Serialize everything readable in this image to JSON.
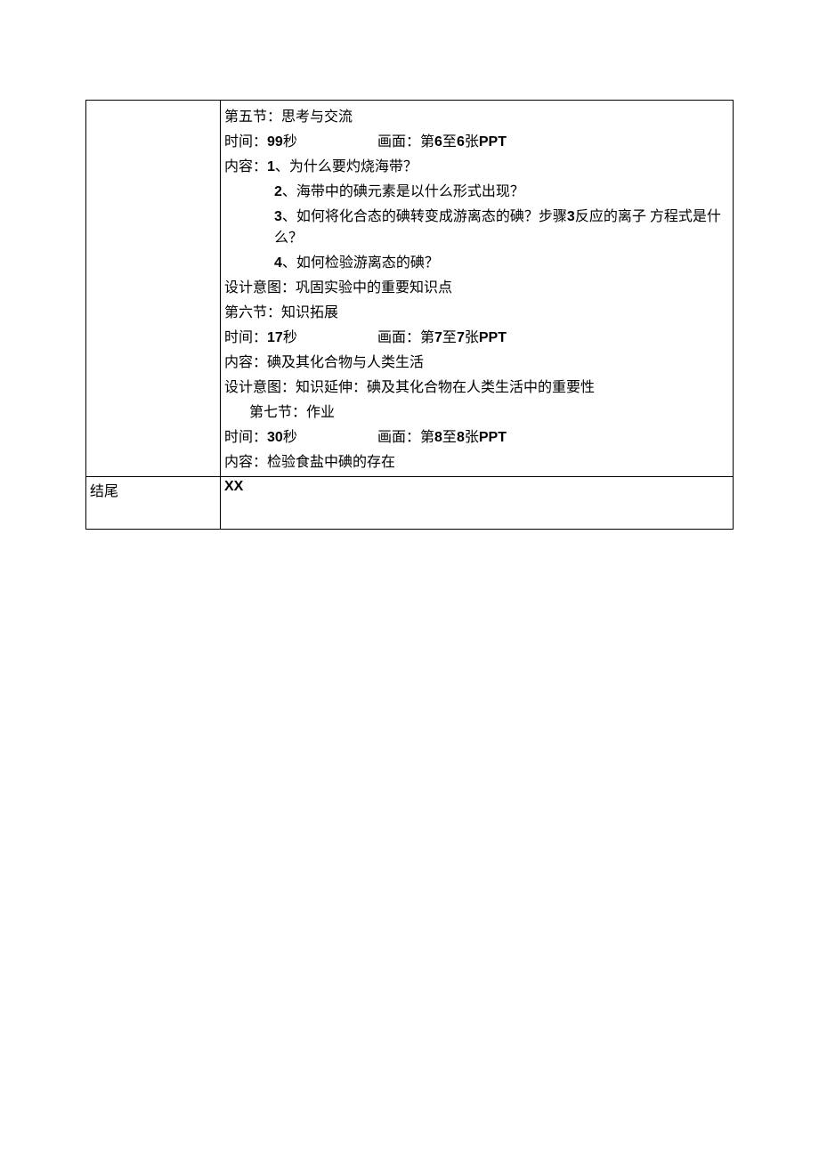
{
  "labels": {
    "time_prefix": "时间：",
    "seconds_suffix": "秒",
    "picture_prefix": "画面：第",
    "picture_middle": "至",
    "picture_suffix": "张",
    "ppt_label": "PPT",
    "content_prefix": "内容：",
    "design_intent_prefix": "设计意图：",
    "footer_label": "结尾"
  },
  "section5": {
    "title": "第五节：思考与交流",
    "time": "99",
    "pic_from": "6",
    "pic_to": "6",
    "content_lead": "1",
    "content_lead_text": "、为什么要灼烧海带？",
    "items": [
      {
        "num": "2",
        "text": "、海带中的碘元素是以什么形式出现？"
      },
      {
        "num": "3",
        "text_a": "、如何将化合态的碘转变成游离态的碘？步骤",
        "num_inline": "3",
        "text_b": "反应的离子 方程式是什么？"
      },
      {
        "num": "4",
        "text": "、如何检验游离态的碘？"
      }
    ],
    "design_intent": "巩固实验中的重要知识点"
  },
  "section6": {
    "title": "第六节：知识拓展",
    "time": "17",
    "pic_from": "7",
    "pic_to": "7",
    "content": "碘及其化合物与人类生活",
    "design_intent": "知识延伸：碘及其化合物在人类生活中的重要性"
  },
  "section7": {
    "title": "第七节：作业",
    "time": "30",
    "pic_from": "8",
    "pic_to": "8",
    "content": "检验食盐中碘的存在"
  },
  "footer": {
    "value": "XX"
  }
}
